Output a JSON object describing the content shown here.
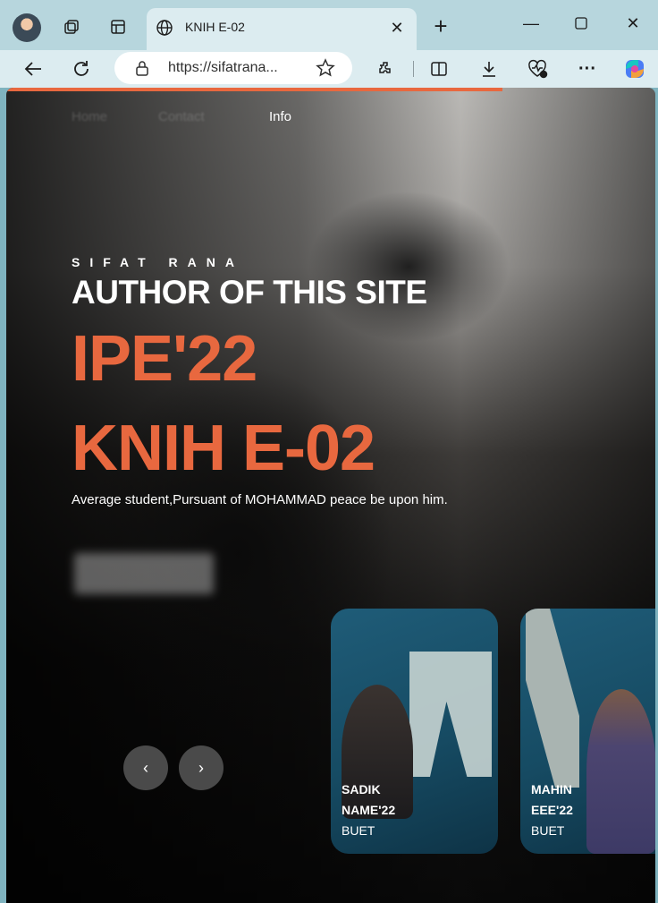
{
  "browser": {
    "tab_title": "KNIH E-02",
    "new_tab_symbol": "+",
    "url": "https://sifatrana...",
    "window_controls": [
      "minimize",
      "maximize",
      "close"
    ]
  },
  "page": {
    "nav": [
      "Home",
      "Contact",
      "Info"
    ],
    "eyebrow": "SIFAT RANA",
    "author_line": "AUTHOR OF THIS SITE",
    "title_1": "IPE'22",
    "title_2": "KNIH E-02",
    "tagline": "Average student,Pursuant of MOHAMMAD peace be upon him.",
    "cards": [
      {
        "name": "SADIK",
        "dept": "NAME'22",
        "uni": "BUET"
      },
      {
        "name": "MAHIN",
        "dept": "EEE'22",
        "uni": "BUET"
      }
    ],
    "prev_symbol": "‹",
    "next_symbol": "›",
    "accent_color": "#e8683f"
  }
}
